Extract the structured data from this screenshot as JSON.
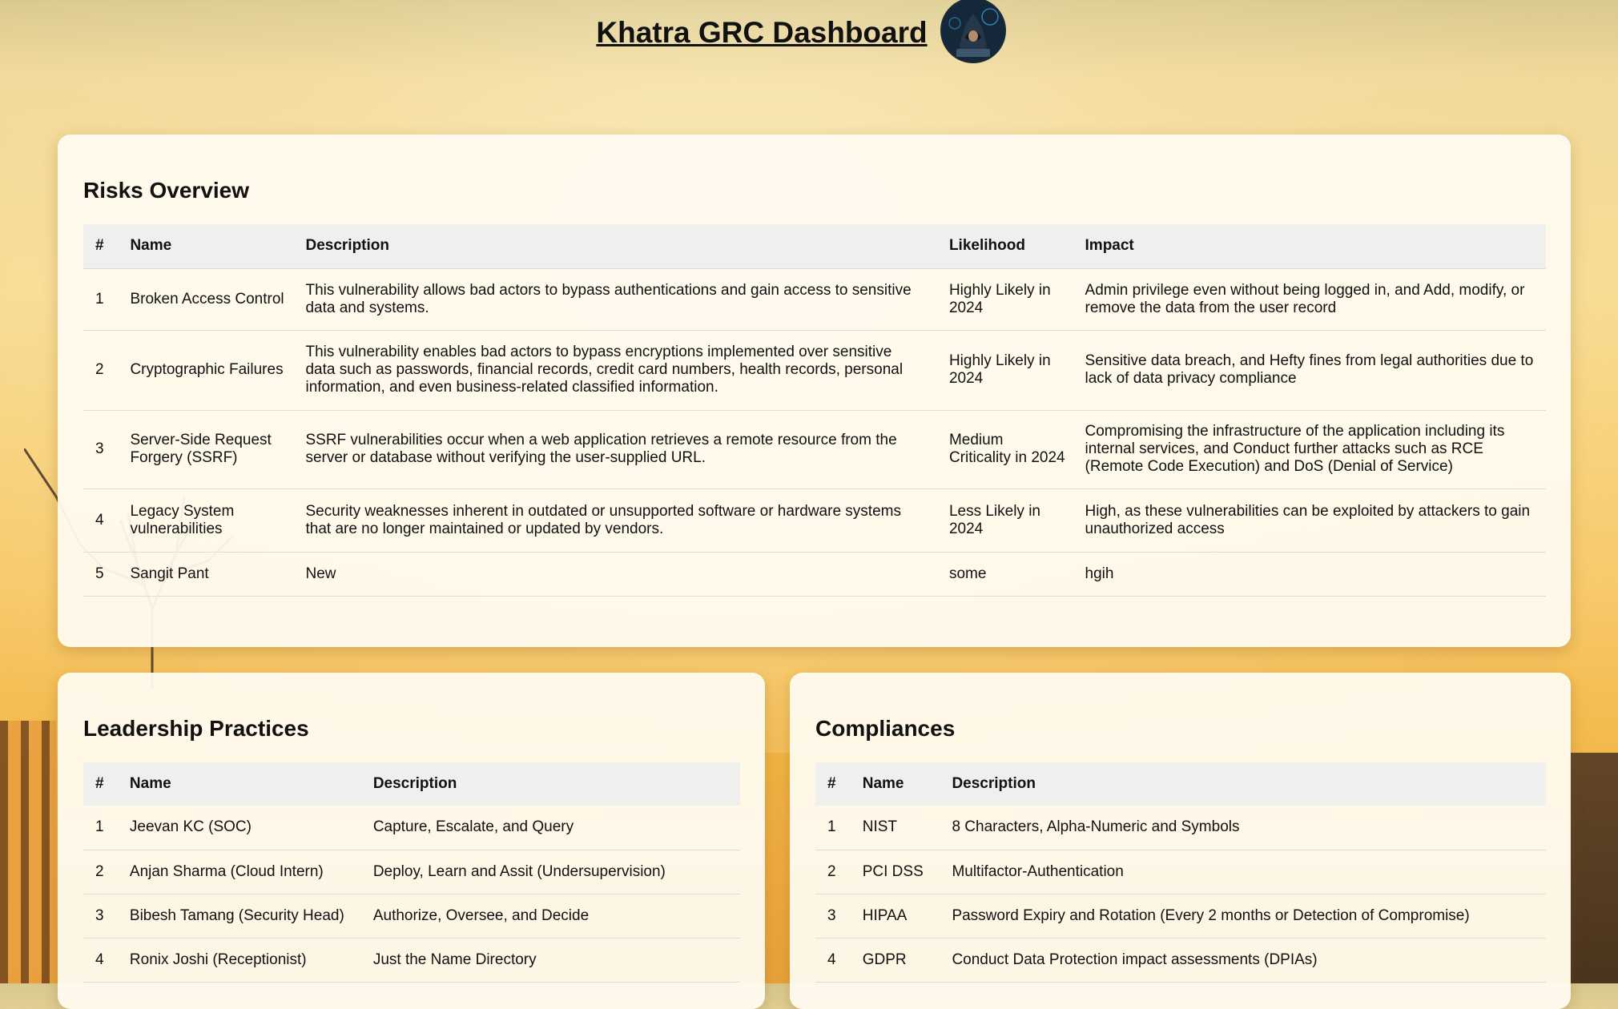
{
  "header": {
    "title": "Khatra GRC Dashboard",
    "avatar_icon": "hooded-hacker-avatar"
  },
  "risks": {
    "heading": "Risks Overview",
    "columns": [
      "#",
      "Name",
      "Description",
      "Likelihood",
      "Impact"
    ],
    "rows": [
      {
        "num": "1",
        "name": "Broken Access Control",
        "description": "This vulnerability allows bad actors to bypass authentications and gain access to sensitive data and systems.",
        "likelihood": "Highly Likely in 2024",
        "impact": "Admin privilege even without being logged in, and Add, modify, or remove the data from the user record"
      },
      {
        "num": "2",
        "name": "Cryptographic Failures",
        "description": "This vulnerability enables bad actors to bypass encryptions implemented over sensitive data such as passwords, financial records, credit card numbers, health records, personal information, and even business-related classified information.",
        "likelihood": "Highly Likely in 2024",
        "impact": "Sensitive data breach, and Hefty fines from legal authorities due to lack of data privacy compliance"
      },
      {
        "num": "3",
        "name": "Server-Side Request Forgery (SSRF)",
        "description": "SSRF vulnerabilities occur when a web application retrieves a remote resource from the server or database without verifying the user-supplied URL.",
        "likelihood": "Medium Criticality in 2024",
        "impact": "Compromising the infrastructure of the application including its internal services, and Conduct further attacks such as RCE (Remote Code Execution) and DoS (Denial of Service)"
      },
      {
        "num": "4",
        "name": "Legacy System vulnerabilities",
        "description": "Security weaknesses inherent in outdated or unsupported software or hardware systems that are no longer maintained or updated by vendors.",
        "likelihood": "Less Likely in 2024",
        "impact": "High, as these vulnerabilities can be exploited by attackers to gain unauthorized access"
      },
      {
        "num": "5",
        "name": "Sangit Pant",
        "description": "New",
        "likelihood": "some",
        "impact": "hgih"
      }
    ]
  },
  "leadership": {
    "heading": "Leadership Practices",
    "columns": [
      "#",
      "Name",
      "Description"
    ],
    "rows": [
      {
        "num": "1",
        "name": "Jeevan KC (SOC)",
        "description": "Capture, Escalate, and Query"
      },
      {
        "num": "2",
        "name": "Anjan Sharma (Cloud Intern)",
        "description": "Deploy, Learn and Assit (Undersupervision)"
      },
      {
        "num": "3",
        "name": "Bibesh Tamang (Security Head)",
        "description": "Authorize, Oversee, and Decide"
      },
      {
        "num": "4",
        "name": "Ronix Joshi (Receptionist)",
        "description": "Just the Name Directory"
      }
    ]
  },
  "compliances": {
    "heading": "Compliances",
    "columns": [
      "#",
      "Name",
      "Description"
    ],
    "rows": [
      {
        "num": "1",
        "name": "NIST",
        "description": "8 Characters, Alpha-Numeric and Symbols"
      },
      {
        "num": "2",
        "name": "PCI DSS",
        "description": "Multifactor-Authentication"
      },
      {
        "num": "3",
        "name": "HIPAA",
        "description": "Password Expiry and Rotation (Every 2 months or Detection of Compromise)"
      },
      {
        "num": "4",
        "name": "GDPR",
        "description": "Conduct Data Protection impact assessments (DPIAs)"
      }
    ]
  }
}
